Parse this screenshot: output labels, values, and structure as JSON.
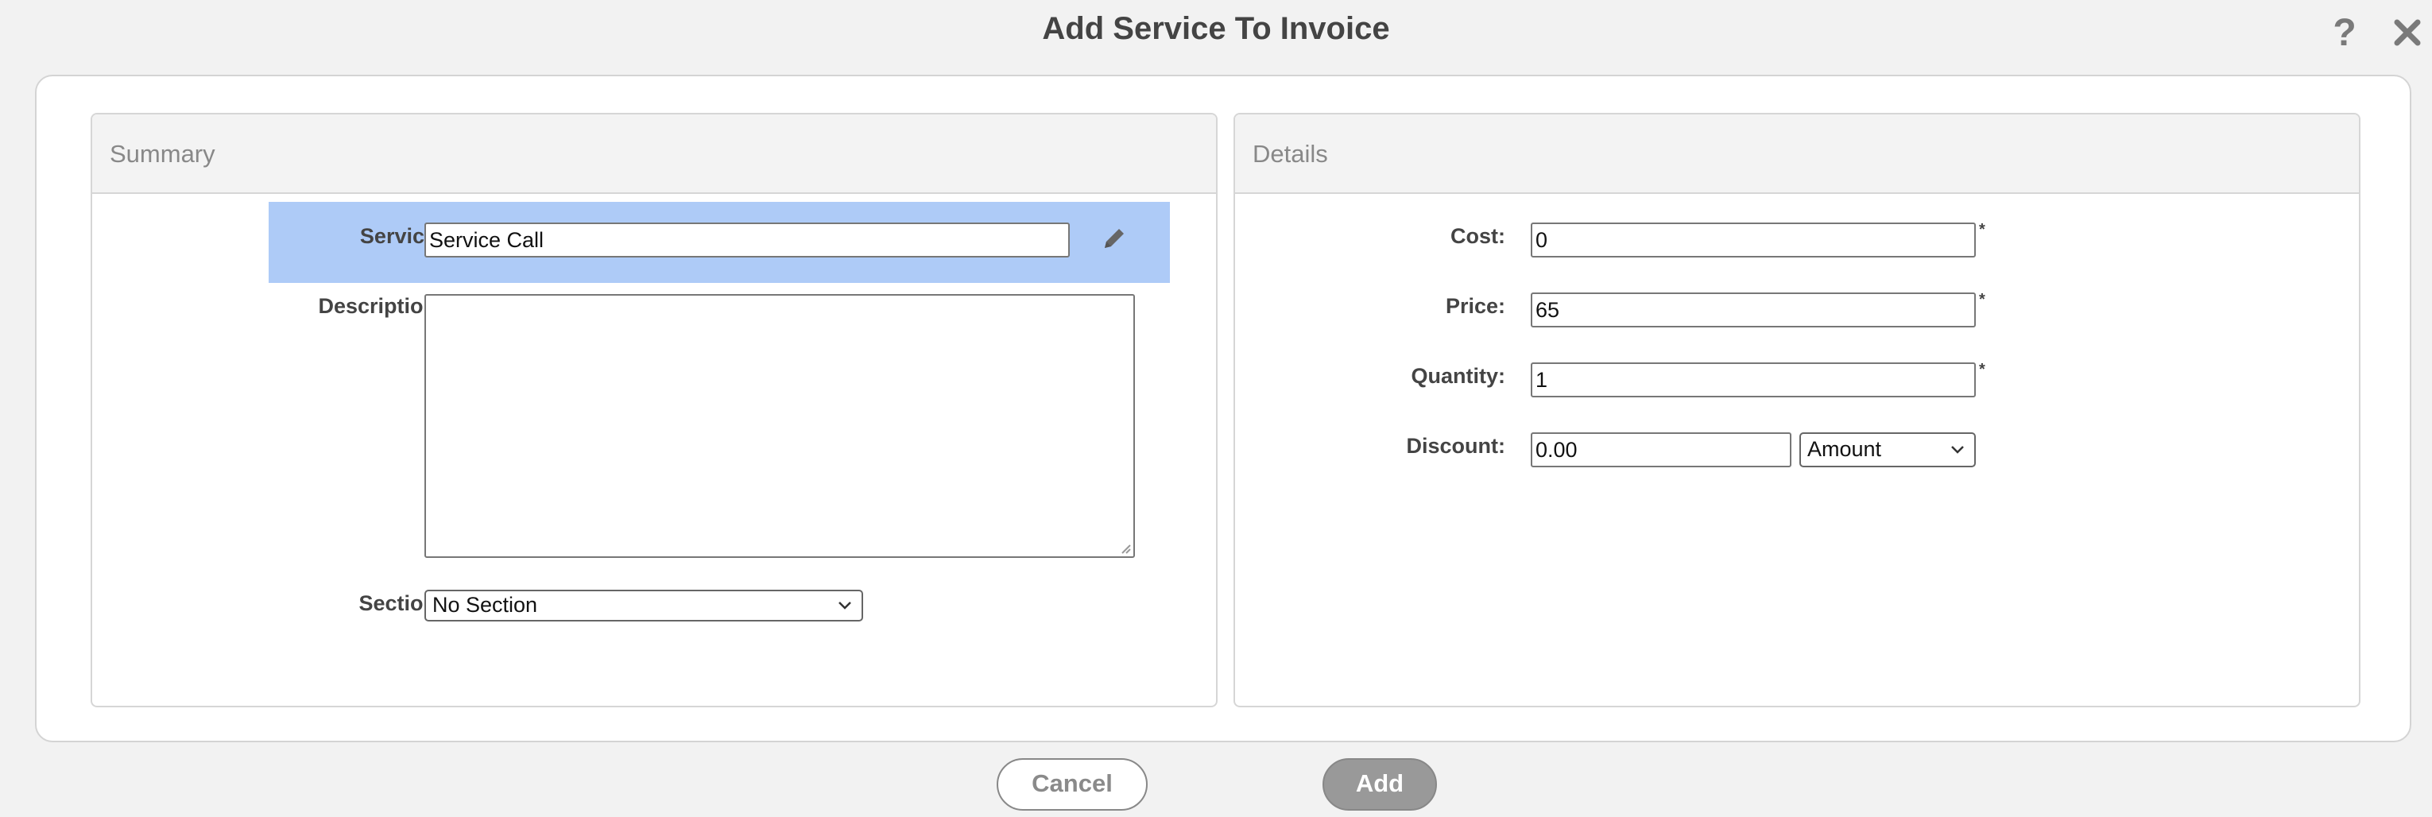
{
  "dialog": {
    "title": "Add Service To Invoice",
    "help_icon": "?",
    "close_icon": "close-icon"
  },
  "summary": {
    "header": "Summary",
    "service_label": "Service:",
    "service_value": "Service Call",
    "description_label": "Description:",
    "description_value": "",
    "section_label": "Section:",
    "section_value": "No Section"
  },
  "details": {
    "header": "Details",
    "cost_label": "Cost:",
    "cost_value": "0",
    "price_label": "Price:",
    "price_value": "65",
    "quantity_label": "Quantity:",
    "quantity_value": "1",
    "discount_label": "Discount:",
    "discount_value": "0.00",
    "discount_type": "Amount",
    "required_marker": "*"
  },
  "footer": {
    "cancel_label": "Cancel",
    "add_label": "Add"
  },
  "colors": {
    "highlight": "#aecbf7",
    "add_button_bg": "#999999"
  }
}
